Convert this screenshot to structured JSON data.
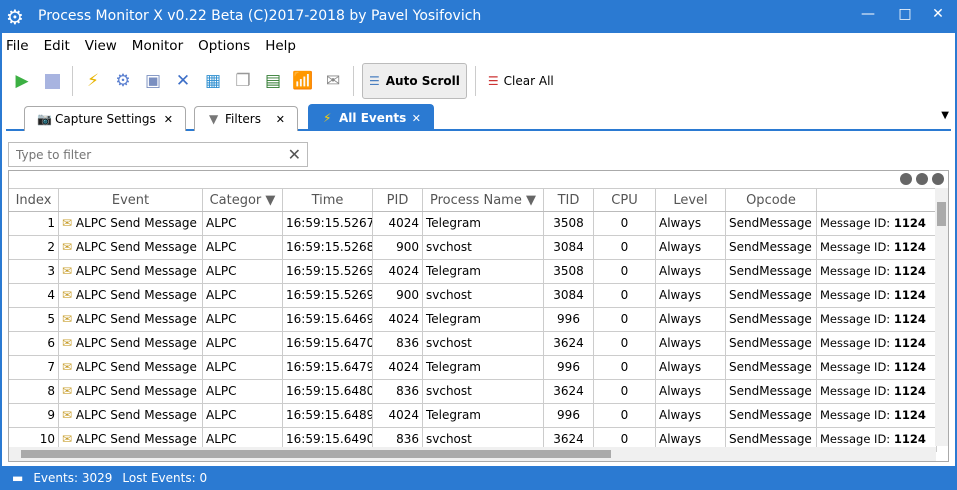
{
  "window": {
    "title": "Process Monitor X v0.22 Beta (C)2017-2018 by Pavel Yosifovich"
  },
  "menu": [
    "File",
    "Edit",
    "View",
    "Monitor",
    "Options",
    "Help"
  ],
  "toolbar": {
    "auto_scroll": "Auto Scroll",
    "clear_all": "Clear All"
  },
  "tabs": [
    {
      "label": "Capture Settings"
    },
    {
      "label": "Filters"
    },
    {
      "label": "All Events"
    }
  ],
  "filter": {
    "placeholder": "Type to filter",
    "value": ""
  },
  "columns": [
    "Index",
    "Event",
    "Categor",
    "Time",
    "PID",
    "Process Name",
    "TID",
    "CPU",
    "Level",
    "Opcode",
    ""
  ],
  "details_label": "Message ID: ",
  "rows": [
    [
      "1",
      "ALPC Send Message",
      "ALPC",
      "16:59:15.5267",
      "4024",
      "Telegram",
      "3508",
      "0",
      "Always",
      "SendMessage",
      "1124"
    ],
    [
      "2",
      "ALPC Send Message",
      "ALPC",
      "16:59:15.5268",
      "900",
      "svchost",
      "3084",
      "0",
      "Always",
      "SendMessage",
      "1124"
    ],
    [
      "3",
      "ALPC Send Message",
      "ALPC",
      "16:59:15.5269",
      "4024",
      "Telegram",
      "3508",
      "0",
      "Always",
      "SendMessage",
      "1124"
    ],
    [
      "4",
      "ALPC Send Message",
      "ALPC",
      "16:59:15.5269",
      "900",
      "svchost",
      "3084",
      "0",
      "Always",
      "SendMessage",
      "1124"
    ],
    [
      "5",
      "ALPC Send Message",
      "ALPC",
      "16:59:15.6469",
      "4024",
      "Telegram",
      "996",
      "0",
      "Always",
      "SendMessage",
      "1124"
    ],
    [
      "6",
      "ALPC Send Message",
      "ALPC",
      "16:59:15.6470",
      "836",
      "svchost",
      "3624",
      "0",
      "Always",
      "SendMessage",
      "1124"
    ],
    [
      "7",
      "ALPC Send Message",
      "ALPC",
      "16:59:15.6479",
      "4024",
      "Telegram",
      "996",
      "0",
      "Always",
      "SendMessage",
      "1124"
    ],
    [
      "8",
      "ALPC Send Message",
      "ALPC",
      "16:59:15.6480",
      "836",
      "svchost",
      "3624",
      "0",
      "Always",
      "SendMessage",
      "1124"
    ],
    [
      "9",
      "ALPC Send Message",
      "ALPC",
      "16:59:15.6489",
      "4024",
      "Telegram",
      "996",
      "0",
      "Always",
      "SendMessage",
      "1124"
    ],
    [
      "10",
      "ALPC Send Message",
      "ALPC",
      "16:59:15.6490",
      "836",
      "svchost",
      "3624",
      "0",
      "Always",
      "SendMessage",
      "1124"
    ]
  ],
  "status": {
    "events": "Events: 3029",
    "lost": "Lost Events: 0"
  }
}
